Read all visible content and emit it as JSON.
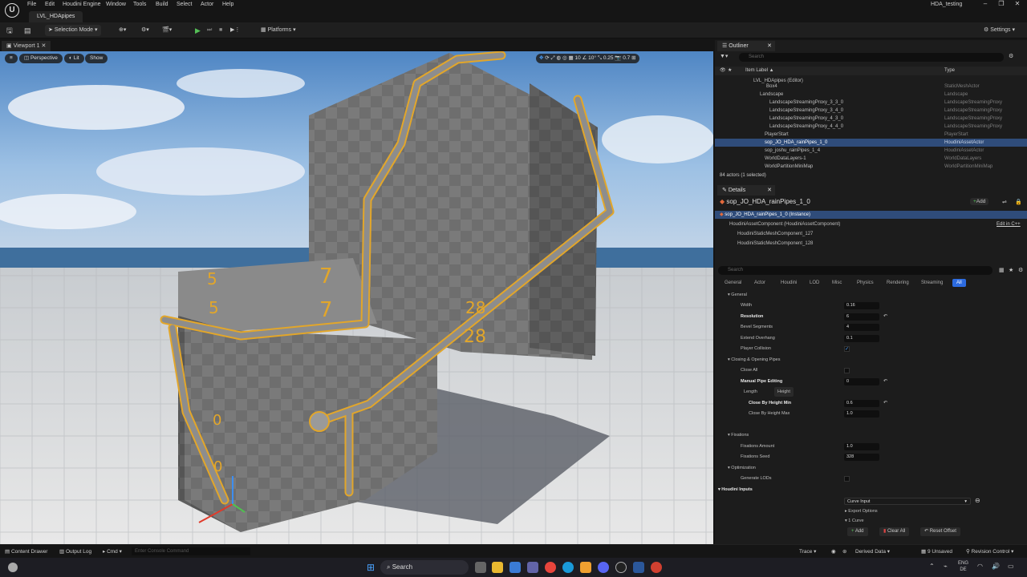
{
  "menu": [
    "File",
    "Edit",
    "Window",
    "Tools",
    "Build",
    "Select",
    "Actor",
    "Help"
  ],
  "extra_menu": "Houdini Engine",
  "level_tab": "LVL_HDApipes",
  "project": "HDA_testing",
  "toolbar": {
    "selection_mode": "Selection Mode",
    "platforms": "Platforms",
    "settings": "Settings"
  },
  "viewport": {
    "tab": "Viewport 1",
    "perspective": "Perspective",
    "lit": "Lit",
    "show": "Show",
    "grid": "10",
    "angle": "10°",
    "scale": "0.25",
    "speed": "0.7",
    "labels": [
      "5",
      "7",
      "5",
      "7",
      "28",
      "28",
      "0",
      "0"
    ]
  },
  "outliner": {
    "tab": "Outliner",
    "search_placeholder": "Search",
    "col_label": "Item Label ▲",
    "col_type": "Type",
    "rows": [
      {
        "label": "LVL_HDApipes (Editor)",
        "type": ""
      },
      {
        "label": "Box4",
        "type": "StaticMeshActor"
      },
      {
        "label": "Landscape",
        "type": "Landscape"
      },
      {
        "label": "LandscapeStreamingProxy_3_3_0",
        "type": "LandscapeStreamingProxy"
      },
      {
        "label": "LandscapeStreamingProxy_3_4_0",
        "type": "LandscapeStreamingProxy"
      },
      {
        "label": "LandscapeStreamingProxy_4_3_0",
        "type": "LandscapeStreamingProxy"
      },
      {
        "label": "LandscapeStreamingProxy_4_4_0",
        "type": "LandscapeStreamingProxy"
      },
      {
        "label": "PlayerStart",
        "type": "PlayerStart"
      },
      {
        "label": "sop_JO_HDA_rainPipes_1_0",
        "type": "HoudiniAssetActor"
      },
      {
        "label": "sop_joshu_rainPipes_1_4",
        "type": "HoudiniAssetActor"
      },
      {
        "label": "WorldDataLayers-1",
        "type": "WorldDataLayers"
      },
      {
        "label": "WorldPartitionMiniMap",
        "type": "WorldPartitionMiniMap"
      }
    ],
    "footer": "84 actors (1 selected)"
  },
  "details": {
    "tab": "Details",
    "actor": "sop_JO_HDA_rainPipes_1_0",
    "add": "Add",
    "instance": "sop_JO_HDA_rainPipes_1_0 (Instance)",
    "component": "HoudiniAssetComponent (HoudiniAssetComponent)",
    "edit_cpp": "Edit in C++",
    "subcomponents": [
      "HoudiniStaticMeshComponent_127",
      "HoudiniStaticMeshComponent_128"
    ],
    "search_placeholder": "Search",
    "filters": [
      "General",
      "Actor",
      "Houdini",
      "LOD",
      "Misc",
      "Physics",
      "Rendering",
      "Streaming",
      "All"
    ],
    "sections": {
      "general": "General",
      "closing": "Closing & Opening Pipes",
      "fixations": "Fixations",
      "optimization": "Optimization",
      "inputs": "Houdini Inputs"
    },
    "props": {
      "width": {
        "label": "Width",
        "value": "0.16"
      },
      "resolution": {
        "label": "Resolution",
        "value": "6"
      },
      "bevel": {
        "label": "Bevel Segments",
        "value": "4"
      },
      "extend": {
        "label": "Extend Overhang",
        "value": "0.1"
      },
      "collision": {
        "label": "Player Collision"
      },
      "close_all": {
        "label": "Close All"
      },
      "manual": {
        "label": "Manual Pipe Editing",
        "value": "0"
      },
      "length": {
        "label": "Length"
      },
      "height": {
        "label": "Height"
      },
      "cbh_min": {
        "label": "Close By Height Min",
        "value": "0.6"
      },
      "cbh_max": {
        "label": "Close By Height Max",
        "value": "1.0"
      },
      "fix_amount": {
        "label": "Fixations Amount",
        "value": "1.0"
      },
      "fix_seed": {
        "label": "Fixations Seed",
        "value": "328"
      },
      "gen_lods": {
        "label": "Generate LODs"
      }
    },
    "curve_input": "Curve Input",
    "export_options": "Export Options",
    "one_curve": "1 Curve",
    "btn_add": "Add",
    "btn_clear": "Clear All",
    "btn_reset": "Reset Offset"
  },
  "status": {
    "content_drawer": "Content Drawer",
    "output_log": "Output Log",
    "cmd": "Cmd",
    "console_placeholder": "Enter Console Command",
    "trace": "Trace",
    "derived": "Derived Data",
    "unsaved": "9 Unsaved",
    "revision": "Revision Control"
  },
  "taskbar": {
    "search": "Search",
    "lang": "ENG",
    "region": "DE"
  }
}
